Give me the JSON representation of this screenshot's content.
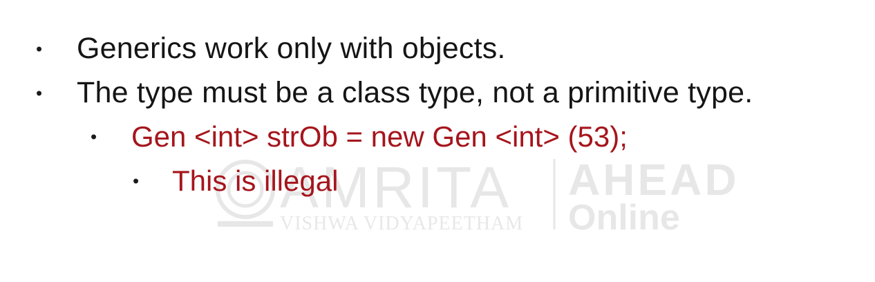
{
  "bullets": [
    {
      "level": 1,
      "text": "Generics work only with objects."
    },
    {
      "level": 1,
      "text": "The type must be a class type, not a primitive type."
    },
    {
      "level": 2,
      "text": "Gen <int> strOb = new Gen <int> (53);"
    },
    {
      "level": 3,
      "text": "This is illegal"
    }
  ],
  "bullet_glyph": "•",
  "watermark": {
    "brand": "AMRITA",
    "subtitle": "VISHWA VIDYAPEETHAM",
    "partner_top": "AHEAD",
    "partner_bottom": "Online"
  },
  "colors": {
    "primary_text": "#151515",
    "accent_red": "#a5151c",
    "background": "#ffffff"
  }
}
